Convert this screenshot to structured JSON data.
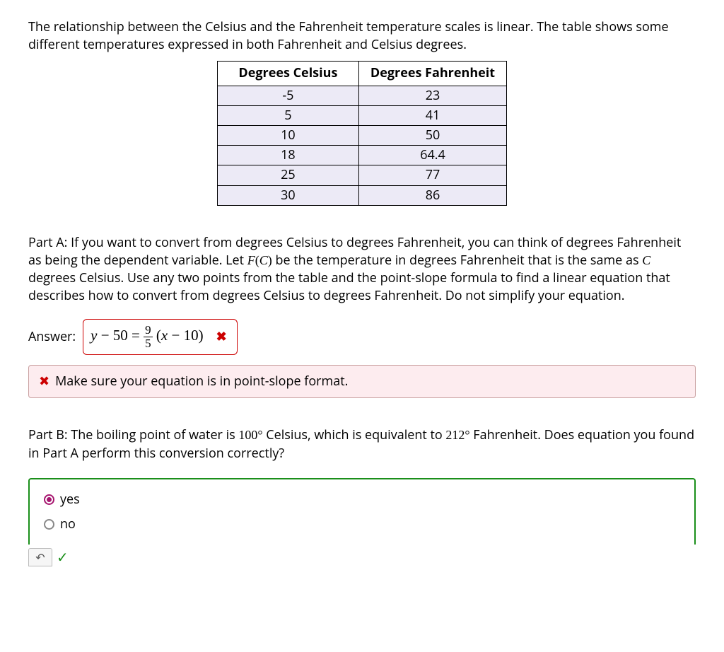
{
  "intro": "The relationship between the Celsius and the Fahrenheit temperature scales is linear. The table shows some different temperatures expressed in both Fahrenheit and Celsius degrees.",
  "table": {
    "headers": {
      "c": "Degrees Celsius",
      "f": "Degrees Fahrenheit"
    },
    "rows": [
      {
        "c": "-5",
        "f": "23"
      },
      {
        "c": "5",
        "f": "41"
      },
      {
        "c": "10",
        "f": "50"
      },
      {
        "c": "18",
        "f": "64.4"
      },
      {
        "c": "25",
        "f": "77"
      },
      {
        "c": "30",
        "f": "86"
      }
    ]
  },
  "partA": {
    "pre1": "Part A: If you want to convert from degrees Celsius to degrees Fahrenheit, you can think of degrees Fahrenheit as being the dependent variable. Let ",
    "fc_F": "F",
    "fc_open": "(",
    "fc_C": "C",
    "fc_close": ")",
    "mid": " be the temperature in degrees Fahrenheit that is the same as ",
    "Cvar": "C",
    "post": " degrees Celsius. Use any two points from the table and the point-slope formula to find a linear equation that describes how to convert from degrees Celsius to degrees Fahrenheit. Do not simplify your equation."
  },
  "answer": {
    "label": "Answer:",
    "eq_left_y": "y",
    "eq_left_rest": " − 50 = ",
    "frac_num": "9",
    "frac_den": "5",
    "eq_right_open": " (",
    "eq_right_x": "x",
    "eq_right_rest": " − 10)",
    "x_icon": "✖"
  },
  "feedback": {
    "icon": "✖",
    "text": "Make sure your equation is in point-slope format."
  },
  "partB": {
    "pre": "Part B: The boiling point of water is ",
    "hundred": "100",
    "deg1": "°",
    "mid1": " Celsius, which is equivalent to ",
    "twotwelve": "212",
    "deg2": "°",
    "post": " Fahrenheit. Does equation you found in Part A perform this conversion correctly?"
  },
  "radios": {
    "yes": "yes",
    "no": "no",
    "selected": "yes"
  },
  "footer": {
    "undo_glyph": "↶",
    "check_glyph": "✓"
  }
}
